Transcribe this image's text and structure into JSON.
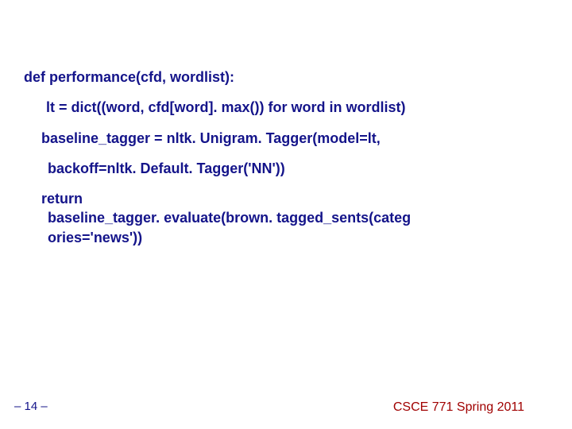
{
  "code": {
    "def_line": "def performance(cfd, wordlist):",
    "lt_line": "lt = dict((word, cfd[word]. max()) for word in wordlist)",
    "baseline_line1": "baseline_tagger = nltk. Unigram. Tagger(model=lt,",
    "baseline_line2": "backoff=nltk. Default. Tagger('NN'))",
    "return_line1": "return",
    "return_line2": "baseline_tagger. evaluate(brown. tagged_sents(categ",
    "return_line3": "ories='news'))"
  },
  "page_number": "– 14 –",
  "footer": "CSCE 771 Spring 2011"
}
